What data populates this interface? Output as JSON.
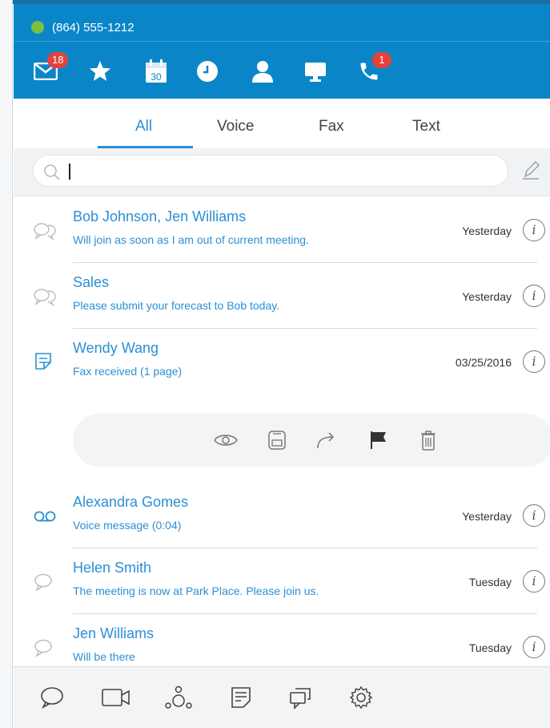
{
  "status": {
    "phone_number": "(864) 555-1212",
    "presence_color": "#7cc040"
  },
  "toolbar": {
    "items": [
      {
        "icon": "envelope-icon",
        "badge": "18"
      },
      {
        "icon": "star-icon"
      },
      {
        "icon": "calendar-icon",
        "calendar_day": "30"
      },
      {
        "icon": "clock-icon"
      },
      {
        "icon": "person-icon"
      },
      {
        "icon": "monitor-icon"
      },
      {
        "icon": "phone-icon",
        "badge": "1"
      }
    ]
  },
  "tabs": [
    {
      "label": "All",
      "active": true
    },
    {
      "label": "Voice",
      "active": false
    },
    {
      "label": "Fax",
      "active": false
    },
    {
      "label": "Text",
      "active": false
    }
  ],
  "search": {
    "value": "",
    "placeholder": ""
  },
  "messages": [
    {
      "icon": "chat-bubbles-icon",
      "name": "Bob Johnson, Jen Williams",
      "preview": "Will join as soon as I am out of current meeting.",
      "time": "Yesterday",
      "info": "i"
    },
    {
      "icon": "chat-bubbles-icon",
      "name": "Sales",
      "preview": "Please submit your forecast to Bob today.",
      "time": "Yesterday",
      "info": "i"
    },
    {
      "icon": "fax-icon",
      "name": "Wendy Wang",
      "preview": "Fax received (1 page)",
      "time": "03/25/2016",
      "info": "i"
    },
    {
      "icon": "voicemail-icon",
      "name": "Alexandra Gomes",
      "preview": "Voice message (0:04)",
      "time": "Yesterday",
      "info": "i"
    },
    {
      "icon": "chat-bubble-icon",
      "name": "Helen Smith",
      "preview": "The meeting is now at Park Place. Please join us.",
      "time": "Tuesday",
      "info": "i"
    },
    {
      "icon": "chat-bubble-icon",
      "name": "Jen Williams",
      "preview": "Will be there",
      "time": "Tuesday",
      "info": "i"
    }
  ],
  "message_actions": [
    "eye-icon",
    "save-icon",
    "forward-icon",
    "flag-icon",
    "trash-icon"
  ],
  "bottom_bar": [
    "chat-icon",
    "video-icon",
    "conference-icon",
    "notes-icon",
    "chat-rooms-icon",
    "settings-icon"
  ],
  "colors": {
    "header_bg": "#0a86c8",
    "accent": "#2b8fd6",
    "badge": "#e3413b"
  }
}
